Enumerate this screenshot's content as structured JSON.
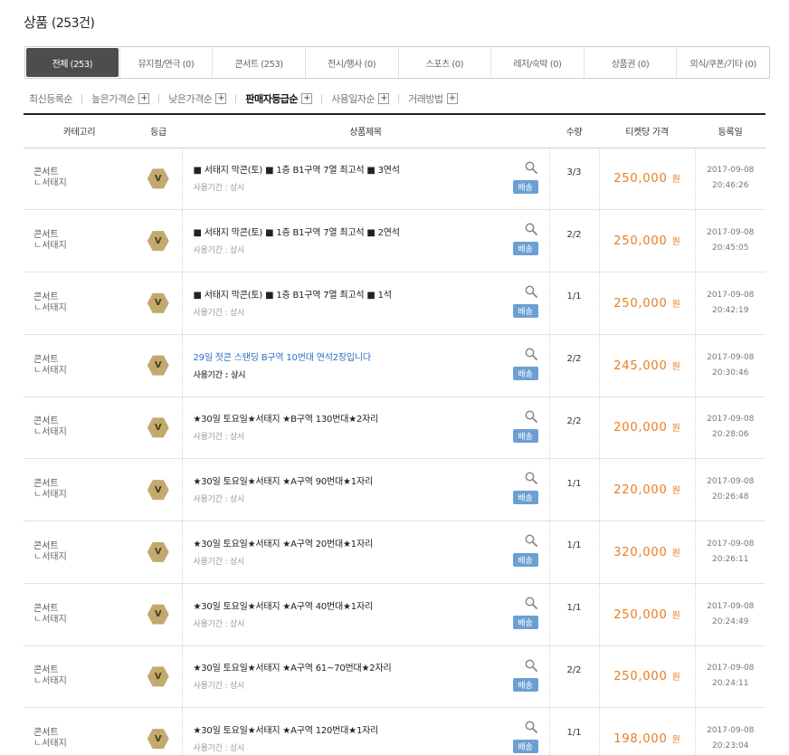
{
  "page": {
    "title": "상품",
    "count": "(253건)"
  },
  "tabs": [
    {
      "label": "전체 (253)",
      "active": true
    },
    {
      "label": "뮤지컬/연극 (0)"
    },
    {
      "label": "콘서트 (253)"
    },
    {
      "label": "전시/행사 (0)"
    },
    {
      "label": "스포츠 (0)"
    },
    {
      "label": "레저/숙박 (0)"
    },
    {
      "label": "상품권 (0)"
    },
    {
      "label": "외식/쿠폰/기타 (0)"
    }
  ],
  "sorts": [
    {
      "label": "최신등록순",
      "plus": false
    },
    {
      "label": "높은가격순",
      "plus": true
    },
    {
      "label": "낮은가격순",
      "plus": true
    },
    {
      "label": "판매자등급순",
      "plus": true,
      "active": true
    },
    {
      "label": "사용일자순",
      "plus": true
    },
    {
      "label": "거래방법",
      "plus": true
    }
  ],
  "table": {
    "headers": {
      "category": "카테고리",
      "grade": "등급",
      "title": "상품제목",
      "qty": "수량",
      "price": "티켓당 가격",
      "date": "등록일"
    },
    "rows": [
      {
        "cat": "콘서트",
        "sub": "ㄴ서태지",
        "grade": "V",
        "title": "■ 서태지 막콘(토) ■ 1층 B1구역 7열 최고석 ■ 3연석",
        "period": "사용기간 : 상시",
        "ship": "배송",
        "qty": "3/3",
        "price": "250,000",
        "won": "원",
        "date": "2017-09-08",
        "time": "20:46:26"
      },
      {
        "cat": "콘서트",
        "sub": "ㄴ서태지",
        "grade": "V",
        "title": "■ 서태지 막콘(토) ■ 1층 B1구역 7열 최고석 ■ 2연석",
        "period": "사용기간 : 상시",
        "ship": "배송",
        "qty": "2/2",
        "price": "250,000",
        "won": "원",
        "date": "2017-09-08",
        "time": "20:45:05"
      },
      {
        "cat": "콘서트",
        "sub": "ㄴ서태지",
        "grade": "V",
        "title": "■ 서태지 막콘(토) ■ 1층 B1구역 7열 최고석 ■ 1석",
        "period": "사용기간 : 상시",
        "ship": "배송",
        "qty": "1/1",
        "price": "250,000",
        "won": "원",
        "date": "2017-09-08",
        "time": "20:42:19"
      },
      {
        "cat": "콘서트",
        "sub": "ㄴ서태지",
        "grade": "V",
        "title": "29일 첫콘 스탠딩 B구역 10번대 연석2장입니다",
        "period": "사용기간 : 상시",
        "ship": "배송",
        "qty": "2/2",
        "price": "245,000",
        "won": "원",
        "date": "2017-09-08",
        "time": "20:30:46",
        "highlight": true
      },
      {
        "cat": "콘서트",
        "sub": "ㄴ서태지",
        "grade": "V",
        "title": "★30일 토요일★서태지 ★B구역 130번대★2자리",
        "period": "사용기간 : 상시",
        "ship": "배송",
        "qty": "2/2",
        "price": "200,000",
        "won": "원",
        "date": "2017-09-08",
        "time": "20:28:06"
      },
      {
        "cat": "콘서트",
        "sub": "ㄴ서태지",
        "grade": "V",
        "title": "★30일 토요일★서태지 ★A구역 90번대★1자리",
        "period": "사용기간 : 상시",
        "ship": "배송",
        "qty": "1/1",
        "price": "220,000",
        "won": "원",
        "date": "2017-09-08",
        "time": "20:26:48"
      },
      {
        "cat": "콘서트",
        "sub": "ㄴ서태지",
        "grade": "V",
        "title": "★30일 토요일★서태지 ★A구역 20번대★1자리",
        "period": "사용기간 : 상시",
        "ship": "배송",
        "qty": "1/1",
        "price": "320,000",
        "won": "원",
        "date": "2017-09-08",
        "time": "20:26:11"
      },
      {
        "cat": "콘서트",
        "sub": "ㄴ서태지",
        "grade": "V",
        "title": "★30일 토요일★서태지 ★A구역 40번대★1자리",
        "period": "사용기간 : 상시",
        "ship": "배송",
        "qty": "1/1",
        "price": "250,000",
        "won": "원",
        "date": "2017-09-08",
        "time": "20:24:49"
      },
      {
        "cat": "콘서트",
        "sub": "ㄴ서태지",
        "grade": "V",
        "title": "★30일 토요일★서태지 ★A구역 61~70번대★2자리",
        "period": "사용기간 : 상시",
        "ship": "배송",
        "qty": "2/2",
        "price": "250,000",
        "won": "원",
        "date": "2017-09-08",
        "time": "20:24:11"
      },
      {
        "cat": "콘서트",
        "sub": "ㄴ서태지",
        "grade": "V",
        "title": "★30일 토요일★서태지 ★A구역 120번대★1자리",
        "period": "사용기간 : 상시",
        "ship": "배송",
        "qty": "1/1",
        "price": "198,000",
        "won": "원",
        "date": "2017-09-08",
        "time": "20:23:04"
      }
    ]
  }
}
